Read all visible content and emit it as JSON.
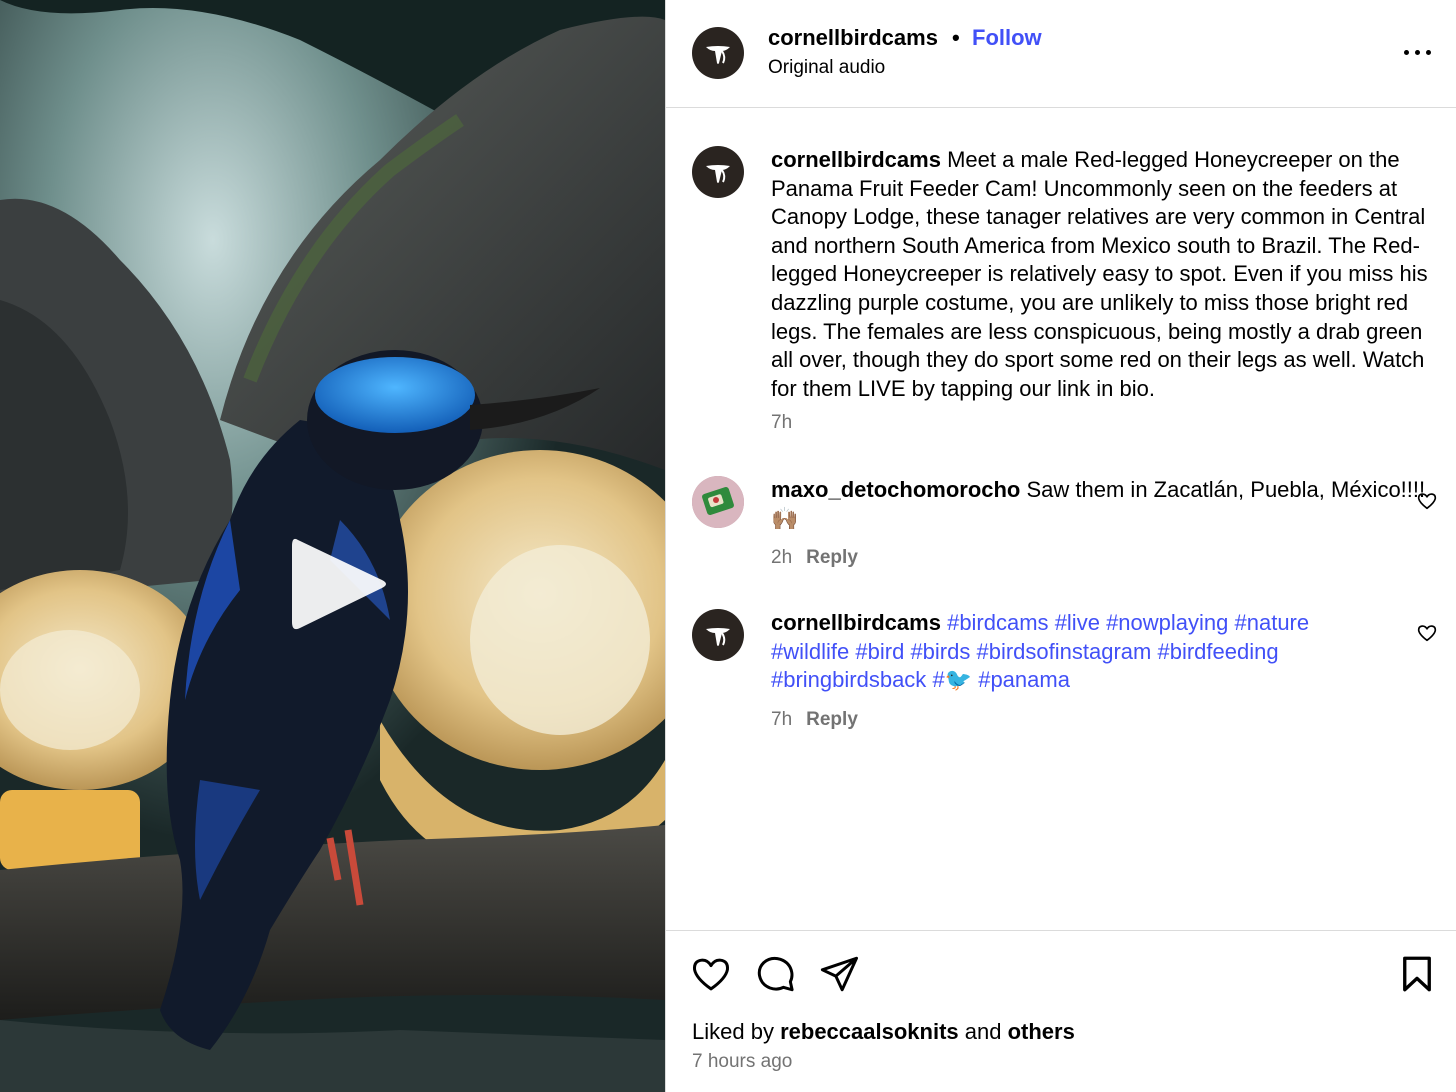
{
  "post": {
    "username": "cornellbirdcams",
    "separator": "•",
    "follow_label": "Follow",
    "audio_label": "Original audio",
    "more_icon": "more-icon"
  },
  "media": {
    "play_icon": "play-icon"
  },
  "caption": {
    "username": "cornellbirdcams",
    "text": "Meet a male Red-legged Honeycreeper on the Panama Fruit Feeder Cam! Uncommonly seen on the feeders at Canopy Lodge, these tanager relatives are very common in Central and northern South America from Mexico south to Brazil. The Red-legged Honeycreeper is relatively easy to spot. Even if you miss his dazzling purple costume, you are unlikely to miss those bright red legs. The females are less conspicuous, being mostly a drab green all over, though they do sport some red on their legs as well. Watch for them LIVE by tapping our link in bio.",
    "time": "7h"
  },
  "comments": [
    {
      "username": "maxo_detochomorocho",
      "text": "Saw them in Zacatlán, Puebla, México!!!!🙌🏽",
      "time": "2h",
      "reply_label": "Reply"
    },
    {
      "username": "cornellbirdcams",
      "hashtags": [
        "#birdcams",
        "#live",
        "#nowplaying",
        "#nature",
        "#wildlife",
        "#bird",
        "#birds",
        "#birdsofinstagram",
        "#birdfeeding",
        "#bringbirdsback",
        "#🐦",
        "#panama"
      ],
      "time": "7h",
      "reply_label": "Reply"
    }
  ],
  "actions": {
    "like_icon": "heart-icon",
    "comment_icon": "comment-icon",
    "share_icon": "share-icon",
    "save_icon": "bookmark-icon"
  },
  "likes": {
    "prefix": "Liked by",
    "user": "rebeccaalsoknits",
    "conj": "and",
    "others": "others"
  },
  "posted_ago": "7 hours ago",
  "colors": {
    "link": "#4150f7",
    "muted": "#737373",
    "border": "#dbdbdb"
  }
}
